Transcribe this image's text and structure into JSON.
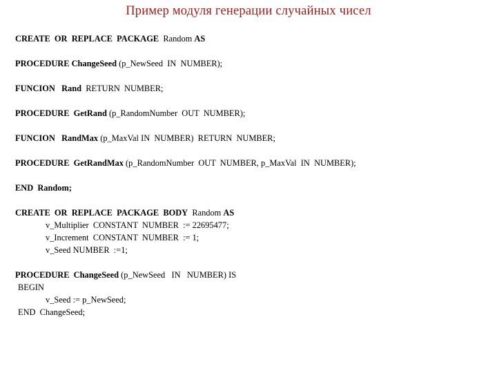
{
  "slide": {
    "title": "Пример модуля генерации случайных чисел",
    "title_color": "#9B1C1C",
    "background_color": "#ffffff",
    "text_color": "#000000"
  },
  "code": {
    "lines": [
      {
        "id": "line-create-package",
        "indent": 0,
        "spaced": false,
        "segments": [
          {
            "text": "CREATE  OR  REPLACE  PACKAGE",
            "bold": true
          },
          {
            "text": "  Random ",
            "bold": false
          },
          {
            "text": "AS",
            "bold": true
          }
        ]
      },
      {
        "id": "line-procedure-changeseed-decl",
        "indent": 0,
        "spaced": true,
        "segments": [
          {
            "text": "PROCEDURE ChangeSeed",
            "bold": true
          },
          {
            "text": " (p_NewSeed  IN  NUMBER);",
            "bold": false
          }
        ]
      },
      {
        "id": "line-funcion-rand-decl",
        "indent": 0,
        "spaced": true,
        "segments": [
          {
            "text": "FUNCION   Rand",
            "bold": true
          },
          {
            "text": "  RETURN  NUMBER;",
            "bold": false
          }
        ]
      },
      {
        "id": "line-procedure-getrand-decl",
        "indent": 0,
        "spaced": true,
        "segments": [
          {
            "text": "PROCEDURE  GetRand",
            "bold": true
          },
          {
            "text": " (p_RandomNumber  OUT  NUMBER);",
            "bold": false
          }
        ]
      },
      {
        "id": "line-funcion-randmax-decl",
        "indent": 0,
        "spaced": true,
        "segments": [
          {
            "text": "FUNCION   RandMax",
            "bold": true
          },
          {
            "text": " (p_MaxVal IN  NUMBER)  RETURN  NUMBER;",
            "bold": false
          }
        ]
      },
      {
        "id": "line-procedure-getrandmax-decl",
        "indent": 0,
        "spaced": true,
        "segments": [
          {
            "text": "PROCEDURE  GetRandMax",
            "bold": true
          },
          {
            "text": " (p_RandomNumber  OUT  NUMBER, p_MaxVal  IN  NUMBER);",
            "bold": false
          }
        ]
      },
      {
        "id": "line-end-random",
        "indent": 0,
        "spaced": true,
        "segments": [
          {
            "text": "END  Random;",
            "bold": true
          }
        ]
      },
      {
        "id": "line-create-package-body",
        "indent": 0,
        "spaced": true,
        "segments": [
          {
            "text": "CREATE  OR  REPLACE  PACKAGE  BODY",
            "bold": true
          },
          {
            "text": "  Random ",
            "bold": false
          },
          {
            "text": "AS",
            "bold": true
          }
        ]
      },
      {
        "id": "line-var-multiplier",
        "indent": 2,
        "spaced": false,
        "segments": [
          {
            "text": "v_Multiplier  CONSTANT  NUMBER  := 22695477;",
            "bold": false
          }
        ]
      },
      {
        "id": "line-var-increment",
        "indent": 2,
        "spaced": false,
        "segments": [
          {
            "text": "v_Increment  CONSTANT  NUMBER  := 1;",
            "bold": false
          }
        ]
      },
      {
        "id": "line-var-seed",
        "indent": 2,
        "spaced": false,
        "segments": [
          {
            "text": "v_Seed NUMBER  :=1;",
            "bold": false
          }
        ]
      },
      {
        "id": "line-procedure-changeseed-body",
        "indent": 0,
        "spaced": true,
        "segments": [
          {
            "text": "PROCEDURE  ChangeSeed",
            "bold": true
          },
          {
            "text": " (p_NewSeed   IN   NUMBER) IS",
            "bold": false
          }
        ]
      },
      {
        "id": "line-begin",
        "indent": 1,
        "spaced": false,
        "segments": [
          {
            "text": "BEGIN",
            "bold": false
          }
        ]
      },
      {
        "id": "line-assign-seed",
        "indent": 2,
        "spaced": false,
        "segments": [
          {
            "text": "v_Seed := p_NewSeed;",
            "bold": false
          }
        ]
      },
      {
        "id": "line-end-changeseed",
        "indent": 1,
        "spaced": false,
        "segments": [
          {
            "text": "END  ChangeSeed;",
            "bold": false
          }
        ]
      }
    ]
  }
}
